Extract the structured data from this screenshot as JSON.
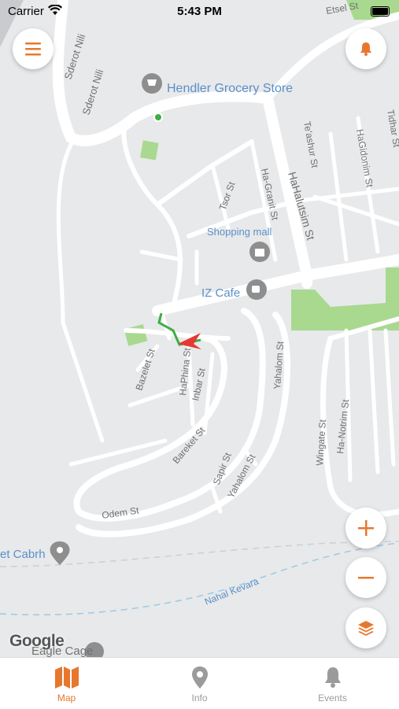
{
  "status_bar": {
    "carrier": "Carrier",
    "time": "5:43 PM"
  },
  "map": {
    "places": {
      "grocery": "Hendler Grocery Store",
      "mall": "Shopping mall",
      "cafe": "IZ Cafe",
      "cabrh": "et Cabrh",
      "eagle": "Eagle Cage"
    },
    "streets": {
      "sderot_nili_1": "Sderot Nili",
      "sderot_nili_2": "Sderot Nili",
      "etsel": "Etsel St",
      "tidhar": "Tidhar St",
      "teashur": "Te'ashur St",
      "hagidonim": "HaGidonim St",
      "hagranit": "Ha-Granit St",
      "halutsim": "HaHalutsim St",
      "tsor": "Tsor St",
      "bazelet": "Bazelet St",
      "haphina": "HaPhina St",
      "inbar": "Inbar St",
      "yahalom1": "Yahalom St",
      "yahalom2": "Yahalom St",
      "wingate": "Wingate St",
      "hanotrim": "Ha-Notrim St",
      "bareket": "Bareket St",
      "sapir": "Sapir St",
      "odem": "Odem St",
      "nahal": "Nahal Kevara"
    },
    "attribution": "Google",
    "accent_color": "#e8772e",
    "park_color": "#a8d98f"
  },
  "tabs": [
    {
      "label": "Map",
      "icon": "map-icon",
      "active": true
    },
    {
      "label": "Info",
      "icon": "pin-icon",
      "active": false
    },
    {
      "label": "Events",
      "icon": "bell-icon",
      "active": false
    }
  ]
}
